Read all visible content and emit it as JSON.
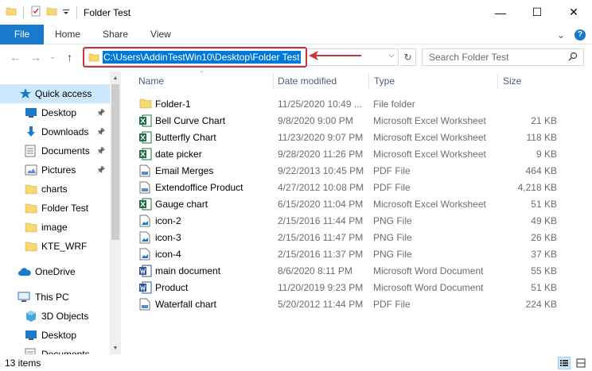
{
  "window": {
    "title": "Folder Test",
    "minimize": "—",
    "maximize": "☐",
    "close": "✕"
  },
  "ribbon": {
    "file": "File",
    "tabs": [
      "Home",
      "Share",
      "View"
    ],
    "expand": "⌄",
    "help": "?"
  },
  "address": {
    "path": "C:\\Users\\AddinTestWin10\\Desktop\\Folder Test",
    "dropdown": "⌵",
    "refresh": "↻"
  },
  "search": {
    "placeholder": "Search Folder Test"
  },
  "nav": {
    "back": "←",
    "forward": "→",
    "recent": "⌄",
    "up": "↑",
    "items": [
      {
        "label": "Quick access",
        "icon": "star-icon",
        "selected": true
      },
      {
        "label": "Desktop",
        "icon": "desktop-icon",
        "pinned": true
      },
      {
        "label": "Downloads",
        "icon": "download-icon",
        "pinned": true
      },
      {
        "label": "Documents",
        "icon": "documents-icon",
        "pinned": true
      },
      {
        "label": "Pictures",
        "icon": "pictures-icon",
        "pinned": true
      },
      {
        "label": "charts",
        "icon": "folder-icon"
      },
      {
        "label": "Folder Test",
        "icon": "folder-icon"
      },
      {
        "label": "image",
        "icon": "folder-icon"
      },
      {
        "label": "KTE_WRF",
        "icon": "folder-icon"
      },
      {
        "label": "OneDrive",
        "icon": "cloud-icon"
      },
      {
        "label": "This PC",
        "icon": "computer-icon"
      },
      {
        "label": "3D Objects",
        "icon": "cube-icon"
      },
      {
        "label": "Desktop",
        "icon": "desktop-icon"
      },
      {
        "label": "Documents",
        "icon": "documents-icon"
      }
    ]
  },
  "columns": {
    "name": "Name",
    "date": "Date modified",
    "type": "Type",
    "size": "Size"
  },
  "files": [
    {
      "name": "Folder-1",
      "date": "11/25/2020 10:49 ...",
      "type": "File folder",
      "size": "",
      "icon": "folder-icon"
    },
    {
      "name": "Bell Curve Chart",
      "date": "9/8/2020 9:00 PM",
      "type": "Microsoft Excel Worksheet",
      "size": "21 KB",
      "icon": "excel-icon"
    },
    {
      "name": "Butterfly Chart",
      "date": "11/23/2020 9:07 PM",
      "type": "Microsoft Excel Worksheet",
      "size": "118 KB",
      "icon": "excel-icon"
    },
    {
      "name": "date picker",
      "date": "9/28/2020 11:26 PM",
      "type": "Microsoft Excel Worksheet",
      "size": "9 KB",
      "icon": "excel-icon"
    },
    {
      "name": "Email Merges",
      "date": "9/22/2013 10:45 PM",
      "type": "PDF File",
      "size": "464 KB",
      "icon": "pdf-icon"
    },
    {
      "name": "Extendoffice Product",
      "date": "4/27/2012 10:08 PM",
      "type": "PDF File",
      "size": "4,218 KB",
      "icon": "pdf-icon"
    },
    {
      "name": "Gauge chart",
      "date": "6/15/2020 11:04 PM",
      "type": "Microsoft Excel Worksheet",
      "size": "51 KB",
      "icon": "excel-icon"
    },
    {
      "name": "icon-2",
      "date": "2/15/2016 11:44 PM",
      "type": "PNG File",
      "size": "49 KB",
      "icon": "image-icon"
    },
    {
      "name": "icon-3",
      "date": "2/15/2016 11:47 PM",
      "type": "PNG File",
      "size": "26 KB",
      "icon": "image-icon"
    },
    {
      "name": "icon-4",
      "date": "2/15/2016 11:37 PM",
      "type": "PNG File",
      "size": "37 KB",
      "icon": "image-icon"
    },
    {
      "name": "main document",
      "date": "8/6/2020 8:11 PM",
      "type": "Microsoft Word Document",
      "size": "55 KB",
      "icon": "word-icon"
    },
    {
      "name": "Product",
      "date": "11/20/2019 9:23 PM",
      "type": "Microsoft Word Document",
      "size": "51 KB",
      "icon": "word-icon"
    },
    {
      "name": "Waterfall chart",
      "date": "5/20/2012 11:44 PM",
      "type": "PDF File",
      "size": "224 KB",
      "icon": "pdf-icon"
    }
  ],
  "status": {
    "count": "13 items"
  },
  "colors": {
    "accent": "#1979ca",
    "selection": "#0078d7",
    "highlight_box": "#c8373f",
    "folder": "#f8d775"
  }
}
